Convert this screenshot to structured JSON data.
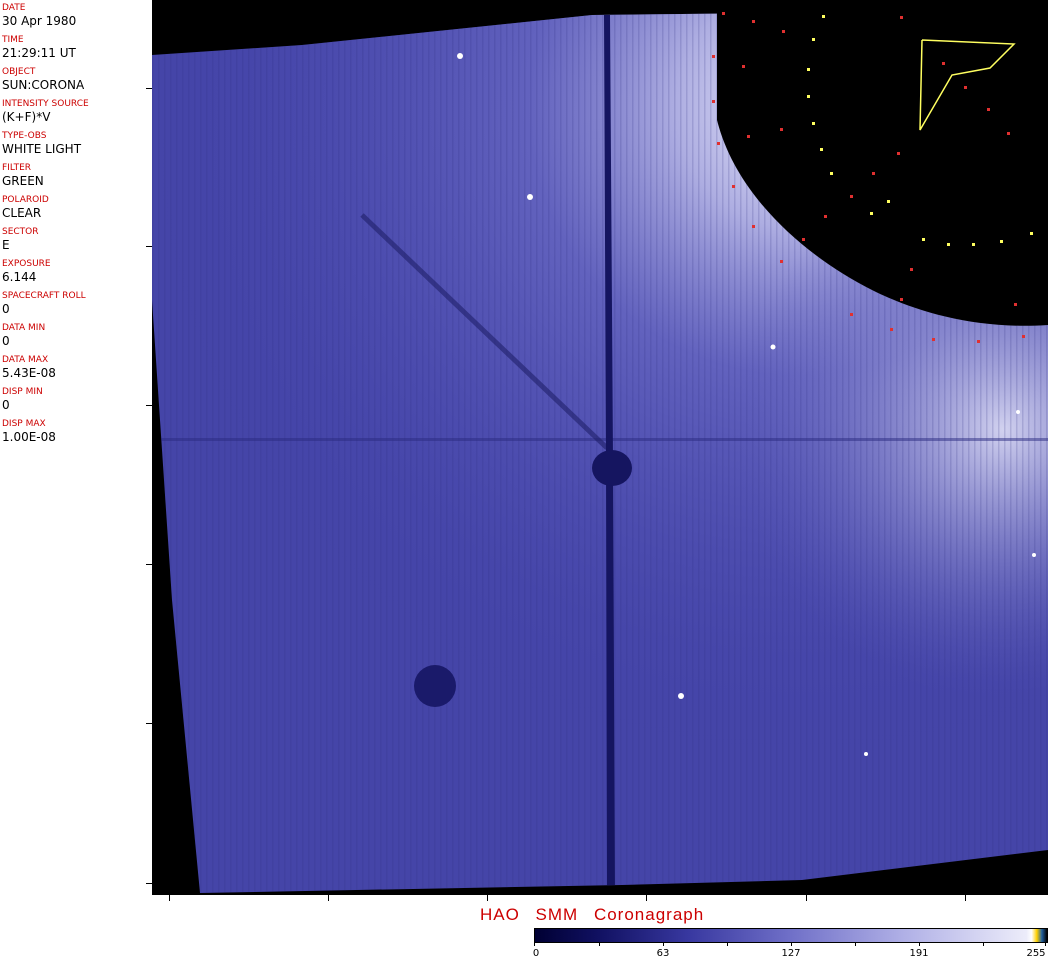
{
  "metadata_fields": [
    {
      "label": "DATE",
      "value": "30 Apr 1980"
    },
    {
      "label": "TIME",
      "value": "21:29:11 UT"
    },
    {
      "label": "OBJECT",
      "value": "SUN:CORONA"
    },
    {
      "label": "INTENSITY SOURCE",
      "value": "(K+F)*V"
    },
    {
      "label": "TYPE-OBS",
      "value": "WHITE LIGHT"
    },
    {
      "label": "FILTER",
      "value": "GREEN"
    },
    {
      "label": "POLAROID",
      "value": "CLEAR"
    },
    {
      "label": "SECTOR",
      "value": "E"
    },
    {
      "label": "EXPOSURE",
      "value": "6.144"
    },
    {
      "label": "SPACECRAFT ROLL",
      "value": "0"
    },
    {
      "label": "DATA MIN",
      "value": "0"
    },
    {
      "label": "DATA MAX",
      "value": "5.43E-08"
    },
    {
      "label": "DISP MIN",
      "value": "0"
    },
    {
      "label": "DISP MAX",
      "value": "1.00E-08"
    }
  ],
  "caption": "HAO SMM Coronagraph",
  "colorbar": {
    "labels": [
      "0",
      "63",
      "127",
      "191",
      "255"
    ],
    "colors": {
      "dark": "#000033",
      "mid": "#5a5ab8",
      "light": "#ffffff",
      "highlight": "#ffd000"
    }
  },
  "colors": {
    "label_red": "#cc0000",
    "corona_blue": "#4a4ab0",
    "background": "#000000"
  }
}
